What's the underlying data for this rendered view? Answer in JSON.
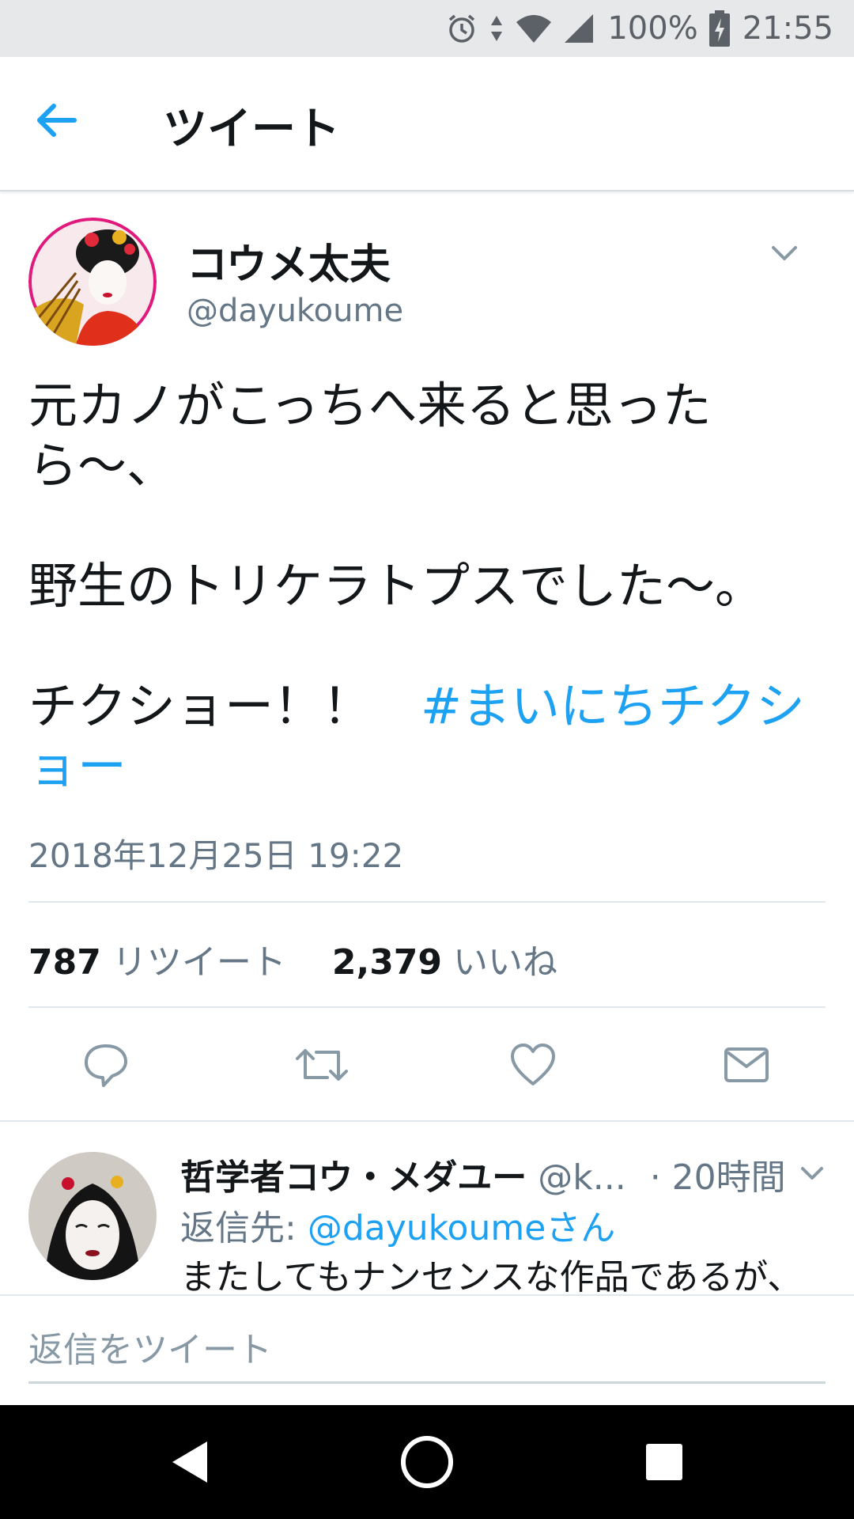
{
  "status_bar": {
    "battery": "100%",
    "time": "21:55",
    "icons": [
      "alarm-icon",
      "data-arrows-icon",
      "wifi-icon",
      "signal-icon",
      "battery-charging-icon"
    ]
  },
  "header": {
    "title": "ツイート",
    "back_icon": "back-arrow-icon"
  },
  "tweet": {
    "author_name": "コウメ太夫",
    "author_handle": "@dayukoume",
    "text_line1": "元カノがこっちへ来ると思ったら〜、",
    "text_line2": "野生のトリケラトプスでした〜。",
    "text_line3": "チクショー！！　",
    "hashtag": "#まいにちチクショー",
    "timestamp": "2018年12月25日 19:22",
    "retweet_count": "787",
    "retweet_label": "リツイート",
    "like_count": "2,379",
    "like_label": "いいね"
  },
  "actions": [
    "reply-icon",
    "retweet-icon",
    "like-icon",
    "share-mail-icon"
  ],
  "reply": {
    "name": "哲学者コウ・メダユー",
    "handle": "@k...",
    "time": "· 20時間",
    "reply_to_prefix": "返信先: ",
    "reply_to_handle": "@dayukoumeさん",
    "text": "またしてもナンセンスな作品であるが、"
  },
  "compose": {
    "placeholder": "返信をツイート"
  },
  "colors": {
    "accent": "#1da1f2",
    "secondary_text": "#657786",
    "primary_text": "#14171a"
  }
}
